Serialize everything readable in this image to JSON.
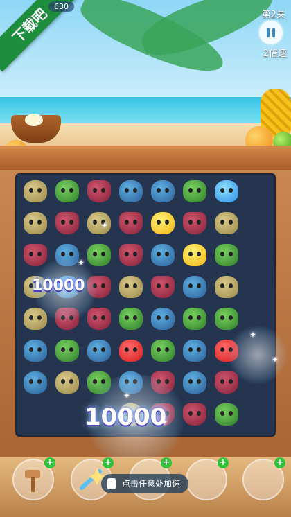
{
  "badge": {
    "label": "下载吧"
  },
  "hud": {
    "score_fragment": "630",
    "level": "第2关",
    "speed": "2倍速"
  },
  "board": {
    "rows": [
      [
        "chick",
        "frog",
        "fox",
        "blue",
        "blue",
        "frog",
        "bright-blue"
      ],
      [
        "chick",
        "fox",
        "chick",
        "fox",
        "gold",
        "fox",
        "chick"
      ],
      [
        "fox",
        "blue",
        "frog",
        "fox",
        "blue",
        "gold",
        "frog"
      ],
      [
        "chick",
        "blue",
        "fox",
        "chick",
        "fox",
        "blue",
        "chick"
      ],
      [
        "chick",
        "fox",
        "fox",
        "frog",
        "blue",
        "frog",
        "frog"
      ],
      [
        "blue",
        "frog",
        "blue",
        "red",
        "frog",
        "blue",
        "red"
      ],
      [
        "blue",
        "chick",
        "frog",
        "blue",
        "fox",
        "blue",
        "fox"
      ],
      [
        "",
        "",
        "",
        "chick",
        "fox",
        "fox",
        "frog"
      ]
    ]
  },
  "popups": {
    "small": "10000",
    "large": "10000"
  },
  "footer": {
    "hint": "点击任意处加速"
  },
  "icons": {
    "pause": "pause-icon",
    "hammer": "hammer-icon",
    "wand": "wand-icon",
    "hand": "hand-pointer-icon"
  }
}
